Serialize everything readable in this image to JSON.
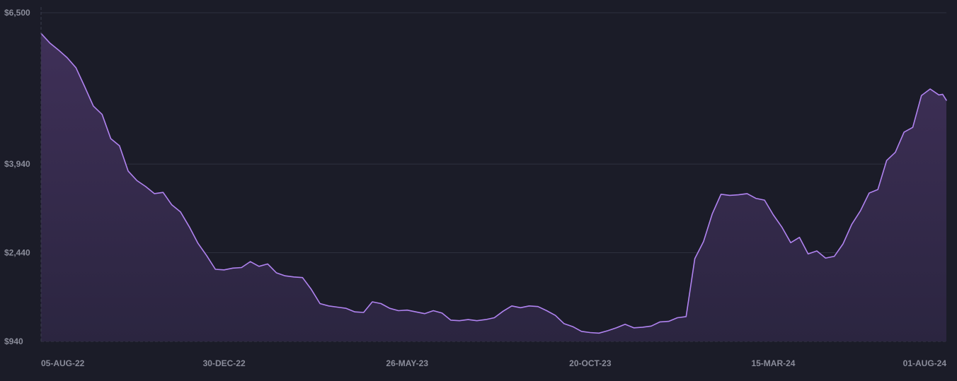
{
  "chart_data": {
    "type": "area",
    "title": "",
    "xlabel": "",
    "ylabel": "",
    "y_tick_labels": [
      "$6,500",
      "$3,940",
      "$2,440",
      "$940"
    ],
    "y_ticks": [
      6500,
      3940,
      2440,
      940
    ],
    "x_tick_labels": [
      "05-AUG-22",
      "30-DEC-22",
      "26-MAY-23",
      "20-OCT-23",
      "15-MAR-24",
      "01-AUG-24"
    ],
    "x_tick_dates": [
      "2022-08-05",
      "2022-12-30",
      "2023-05-26",
      "2023-10-20",
      "2024-03-15",
      "2024-08-01"
    ],
    "ylim": [
      940,
      6500
    ],
    "x_range": [
      "2022-08-05",
      "2024-08-01"
    ],
    "grid": "horizontal",
    "legend": "none",
    "series": [
      {
        "values": [
          [
            "2022-08-05",
            6150
          ],
          [
            "2022-08-12",
            5990
          ],
          [
            "2022-08-19",
            5870
          ],
          [
            "2022-08-26",
            5740
          ],
          [
            "2022-09-02",
            5570
          ],
          [
            "2022-09-09",
            5250
          ],
          [
            "2022-09-16",
            4920
          ],
          [
            "2022-09-23",
            4780
          ],
          [
            "2022-09-30",
            4370
          ],
          [
            "2022-10-07",
            4250
          ],
          [
            "2022-10-14",
            3820
          ],
          [
            "2022-10-21",
            3660
          ],
          [
            "2022-10-28",
            3560
          ],
          [
            "2022-11-04",
            3440
          ],
          [
            "2022-11-11",
            3460
          ],
          [
            "2022-11-18",
            3250
          ],
          [
            "2022-11-25",
            3130
          ],
          [
            "2022-12-02",
            2880
          ],
          [
            "2022-12-09",
            2600
          ],
          [
            "2022-12-16",
            2390
          ],
          [
            "2022-12-23",
            2160
          ],
          [
            "2022-12-30",
            2150
          ],
          [
            "2023-01-06",
            2180
          ],
          [
            "2023-01-13",
            2190
          ],
          [
            "2023-01-20",
            2290
          ],
          [
            "2023-01-27",
            2210
          ],
          [
            "2023-02-03",
            2250
          ],
          [
            "2023-02-10",
            2100
          ],
          [
            "2023-02-17",
            2050
          ],
          [
            "2023-02-24",
            2030
          ],
          [
            "2023-03-03",
            2020
          ],
          [
            "2023-03-10",
            1820
          ],
          [
            "2023-03-17",
            1580
          ],
          [
            "2023-03-24",
            1540
          ],
          [
            "2023-03-31",
            1520
          ],
          [
            "2023-04-07",
            1500
          ],
          [
            "2023-04-14",
            1440
          ],
          [
            "2023-04-21",
            1430
          ],
          [
            "2023-04-28",
            1610
          ],
          [
            "2023-05-05",
            1580
          ],
          [
            "2023-05-12",
            1500
          ],
          [
            "2023-05-19",
            1460
          ],
          [
            "2023-05-26",
            1470
          ],
          [
            "2023-06-02",
            1440
          ],
          [
            "2023-06-09",
            1410
          ],
          [
            "2023-06-16",
            1460
          ],
          [
            "2023-06-23",
            1420
          ],
          [
            "2023-06-30",
            1300
          ],
          [
            "2023-07-07",
            1290
          ],
          [
            "2023-07-14",
            1310
          ],
          [
            "2023-07-21",
            1290
          ],
          [
            "2023-07-28",
            1310
          ],
          [
            "2023-08-04",
            1340
          ],
          [
            "2023-08-11",
            1450
          ],
          [
            "2023-08-18",
            1540
          ],
          [
            "2023-08-25",
            1510
          ],
          [
            "2023-09-01",
            1540
          ],
          [
            "2023-09-08",
            1530
          ],
          [
            "2023-09-15",
            1460
          ],
          [
            "2023-09-22",
            1380
          ],
          [
            "2023-09-29",
            1240
          ],
          [
            "2023-10-06",
            1190
          ],
          [
            "2023-10-13",
            1110
          ],
          [
            "2023-10-20",
            1090
          ],
          [
            "2023-10-27",
            1080
          ],
          [
            "2023-11-03",
            1120
          ],
          [
            "2023-11-10",
            1170
          ],
          [
            "2023-11-17",
            1230
          ],
          [
            "2023-11-24",
            1170
          ],
          [
            "2023-12-01",
            1180
          ],
          [
            "2023-12-08",
            1200
          ],
          [
            "2023-12-15",
            1270
          ],
          [
            "2023-12-22",
            1280
          ],
          [
            "2023-12-29",
            1340
          ],
          [
            "2024-01-05",
            1360
          ],
          [
            "2024-01-12",
            2340
          ],
          [
            "2024-01-19",
            2630
          ],
          [
            "2024-01-26",
            3100
          ],
          [
            "2024-02-02",
            3430
          ],
          [
            "2024-02-09",
            3410
          ],
          [
            "2024-02-16",
            3420
          ],
          [
            "2024-02-23",
            3440
          ],
          [
            "2024-03-01",
            3360
          ],
          [
            "2024-03-08",
            3330
          ],
          [
            "2024-03-15",
            3080
          ],
          [
            "2024-03-22",
            2870
          ],
          [
            "2024-03-29",
            2610
          ],
          [
            "2024-04-05",
            2700
          ],
          [
            "2024-04-12",
            2420
          ],
          [
            "2024-04-19",
            2470
          ],
          [
            "2024-04-26",
            2350
          ],
          [
            "2024-05-03",
            2380
          ],
          [
            "2024-05-10",
            2590
          ],
          [
            "2024-05-17",
            2920
          ],
          [
            "2024-05-24",
            3150
          ],
          [
            "2024-05-31",
            3450
          ],
          [
            "2024-06-07",
            3510
          ],
          [
            "2024-06-14",
            4000
          ],
          [
            "2024-06-21",
            4140
          ],
          [
            "2024-06-28",
            4480
          ],
          [
            "2024-07-05",
            4560
          ],
          [
            "2024-07-12",
            5100
          ],
          [
            "2024-07-19",
            5210
          ],
          [
            "2024-07-26",
            5110
          ],
          [
            "2024-07-29",
            5120
          ],
          [
            "2024-08-01",
            5020
          ]
        ],
        "color": "#b083f0",
        "fill_color": "#3a2e53"
      }
    ]
  }
}
